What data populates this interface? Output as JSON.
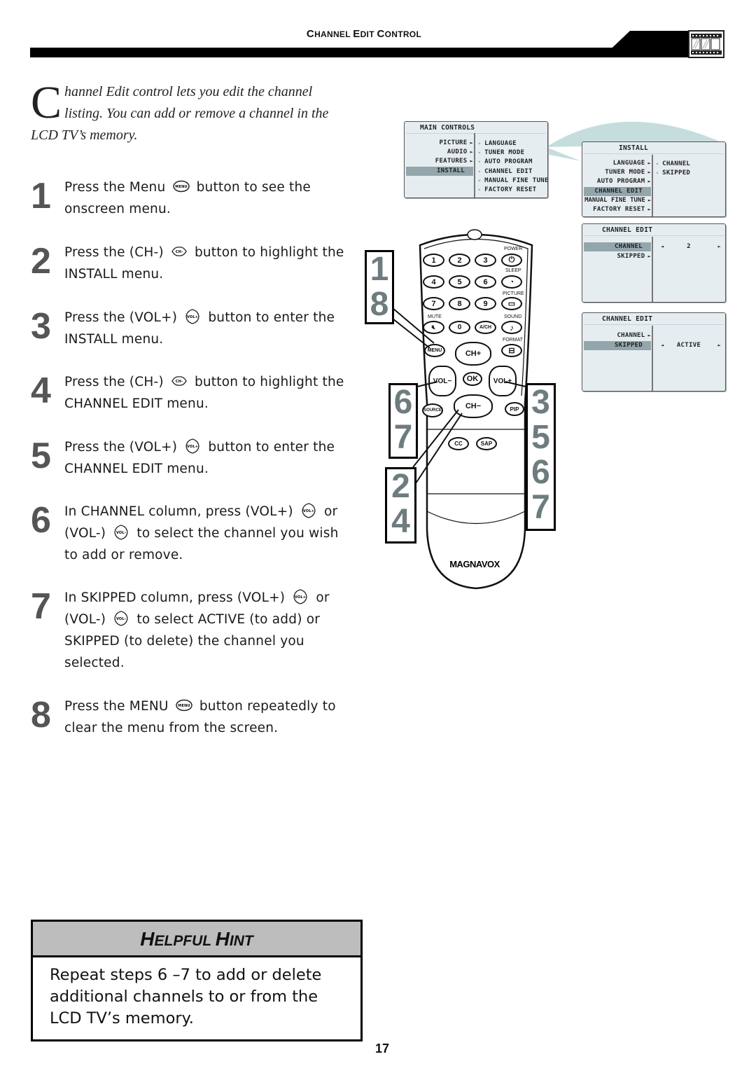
{
  "header": {
    "title_parts": [
      {
        "cap": "C",
        "rest": "HANNEL "
      },
      {
        "cap": "E",
        "rest": "DIT "
      },
      {
        "cap": "C",
        "rest": "ONTROL"
      }
    ],
    "icon": "film-strip-icon"
  },
  "intro": {
    "dropcap": "C",
    "text": "hannel Edit control lets you edit the channel listing. You can add or remove a channel in the LCD TV’s memory."
  },
  "steps": [
    {
      "num": "1",
      "before": "Press the Menu",
      "icon": "menu-button-icon",
      "after": "button to see the onscreen menu."
    },
    {
      "num": "2",
      "before": "Press the (CH-)",
      "icon": "ch-minus-button-icon",
      "after": "button to highlight the INSTALL menu."
    },
    {
      "num": "3",
      "before": "Press the (VOL+)",
      "icon": "vol-plus-button-icon",
      "after": "button to enter the INSTALL menu."
    },
    {
      "num": "4",
      "before": "Press the (CH-)",
      "icon": "ch-minus-button-icon",
      "after": "button to highlight the CHANNEL EDIT menu."
    },
    {
      "num": "5",
      "before": "Press the (VOL+)",
      "icon": "vol-plus-button-icon",
      "after": "button to enter the CHANNEL EDIT menu."
    },
    {
      "num": "6",
      "before": "In CHANNEL column, press (VOL+)",
      "icon": "vol-plus-button-icon",
      "middle": "or (VOL-)",
      "icon2": "vol-minus-button-icon",
      "after": "to select the channel you wish to add or remove."
    },
    {
      "num": "7",
      "before": "In SKIPPED column, press (VOL+)",
      "icon": "vol-plus-button-icon",
      "middle": "or (VOL-)",
      "icon2": "vol-minus-button-icon",
      "after": "to select ACTIVE (to add) or SKIPPED (to delete) the channel you selected."
    },
    {
      "num": "8",
      "before": "Press the MENU",
      "icon": "menu-button-icon",
      "after": "button repeatedly to clear the menu from the screen."
    }
  ],
  "hint": {
    "title_parts": [
      {
        "cap": "H",
        "rest": "ELPFUL "
      },
      {
        "cap": "H",
        "rest": "INT"
      }
    ],
    "body": "Repeat steps 6 –7 to add or delete additional channels to or from the LCD TV’s memory."
  },
  "page_number": "17",
  "osd_main": {
    "title": "MAIN CONTROLS",
    "left_items": [
      {
        "label": "PICTURE",
        "arrow": true,
        "highlight": false
      },
      {
        "label": "AUDIO",
        "arrow": true,
        "highlight": false
      },
      {
        "label": "FEATURES",
        "arrow": true,
        "highlight": false
      },
      {
        "label": "INSTALL",
        "arrow": false,
        "highlight": true
      }
    ],
    "right_items": [
      "LANGUAGE",
      "TUNER MODE",
      "AUTO PROGRAM",
      "CHANNEL EDIT",
      "MANUAL FINE TUNE",
      "FACTORY RESET"
    ]
  },
  "osd_install": {
    "title": "INSTALL",
    "left_items": [
      {
        "label": "LANGUAGE",
        "arrow": true,
        "highlight": false
      },
      {
        "label": "TUNER MODE",
        "arrow": true,
        "highlight": false
      },
      {
        "label": "AUTO PROGRAM",
        "arrow": true,
        "highlight": false
      },
      {
        "label": "CHANNEL EDIT",
        "arrow": false,
        "highlight": true
      },
      {
        "label": "MANUAL FINE TUNE",
        "arrow": true,
        "highlight": false
      },
      {
        "label": "FACTORY RESET",
        "arrow": true,
        "highlight": false
      }
    ],
    "right_items": [
      "CHANNEL",
      "SKIPPED"
    ]
  },
  "osd_channel_edit_1": {
    "title": "CHANNEL EDIT",
    "left_items": [
      {
        "label": "CHANNEL",
        "arrow": false,
        "highlight": true
      },
      {
        "label": "SKIPPED",
        "arrow": true,
        "highlight": false
      }
    ],
    "value_row": 0,
    "value": "2"
  },
  "osd_channel_edit_2": {
    "title": "CHANNEL EDIT",
    "left_items": [
      {
        "label": "CHANNEL",
        "arrow": true,
        "highlight": false
      },
      {
        "label": "SKIPPED",
        "arrow": false,
        "highlight": true
      }
    ],
    "value_row": 1,
    "value": "ACTIVE"
  },
  "remote": {
    "brand": "MAGNAVOX",
    "number_keys": [
      "1",
      "2",
      "3",
      "4",
      "5",
      "6",
      "7",
      "8",
      "9"
    ],
    "side_labels": [
      "POWER",
      "SLEEP",
      "PICTURE",
      "SOUND",
      "FORMAT"
    ],
    "mute_label": "MUTE",
    "zero_key": "0",
    "ach_key": "A/CH",
    "menu_key": "MENU",
    "ch_plus": "CH+",
    "ch_minus": "CH−",
    "vol_minus": "VOL−",
    "vol_plus": "VOL+",
    "ok": "OK",
    "source": "SOURCE",
    "pip": "PIP",
    "cc": "CC",
    "sap": "SAP"
  },
  "callouts": {
    "menu": [
      "1",
      "8"
    ],
    "vol_minus": [
      "6",
      "7"
    ],
    "ch_minus": [
      "2",
      "4"
    ],
    "vol_plus": [
      "3",
      "5",
      "6",
      "7"
    ]
  },
  "colors": {
    "osd_bg": "#e6edf0",
    "osd_highlight": "#93a6ac",
    "connector": "#c5dedd",
    "callout_digit": "#6e7c80",
    "hint_header": "#bdbdbd"
  }
}
